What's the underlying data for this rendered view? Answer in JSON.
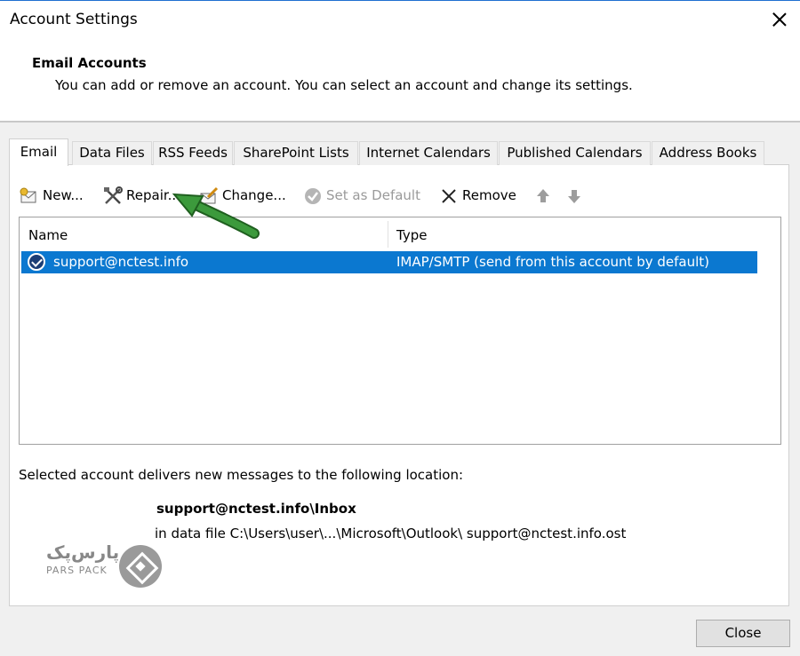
{
  "window": {
    "title": "Account Settings"
  },
  "header": {
    "title": "Email Accounts",
    "subtitle": "You can add or remove an account. You can select an account and change its settings."
  },
  "tabs": [
    {
      "label": "Email"
    },
    {
      "label": "Data Files"
    },
    {
      "label": "RSS Feeds"
    },
    {
      "label": "SharePoint Lists"
    },
    {
      "label": "Internet Calendars"
    },
    {
      "label": "Published Calendars"
    },
    {
      "label": "Address Books"
    }
  ],
  "toolbar": {
    "new_label": "New...",
    "repair_label": "Repair...",
    "change_label": "Change...",
    "set_default_label": "Set as Default",
    "remove_label": "Remove"
  },
  "account_list": {
    "columns": [
      "Name",
      "Type"
    ],
    "rows": [
      {
        "name": "support@nctest.info",
        "type": "IMAP/SMTP (send from this account by default)"
      }
    ]
  },
  "location": {
    "label": "Selected account delivers new messages to the following location:",
    "inbox": "support@nctest.info\\Inbox",
    "data_file": "in data file C:\\Users\\user\\...\\Microsoft\\Outlook\\ support@nctest.info.ost"
  },
  "watermark": {
    "name_fa": "پارس‌پک",
    "name_en": "PARS PACK"
  },
  "footer": {
    "close_label": "Close"
  },
  "colors": {
    "selection": "#0b78d0",
    "annotation_arrow": "#2e8b2e"
  }
}
